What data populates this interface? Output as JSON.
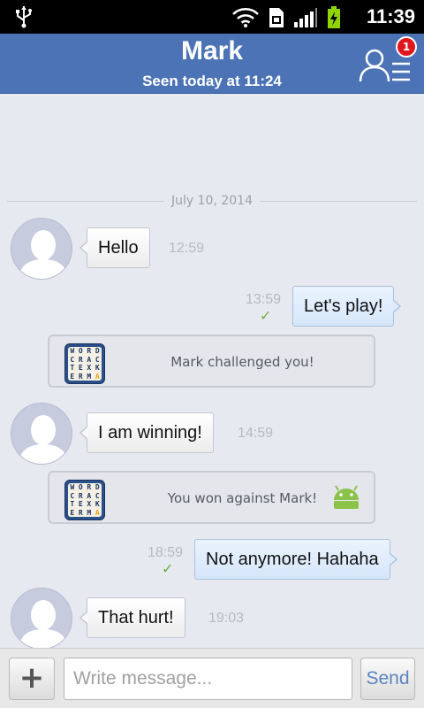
{
  "status_bar": {
    "time": "11:39"
  },
  "header": {
    "contact_name": "Mark",
    "last_seen": "Seen today at 11:24",
    "friend_requests_badge": "1"
  },
  "conversation": {
    "date": "July 10, 2014",
    "messages": [
      {
        "direction": "in",
        "text": "Hello",
        "time": "12:59"
      },
      {
        "direction": "out",
        "text": "Let's play!",
        "time": "13:59",
        "delivered": true
      },
      {
        "type": "event",
        "text": "Mark challenged you!",
        "icon": "wordcrack-game-icon"
      },
      {
        "direction": "in",
        "text": "I am winning!",
        "time": "14:59"
      },
      {
        "type": "event",
        "text": "You won against Mark!",
        "icon": "wordcrack-game-icon",
        "platform_icon": "android-icon"
      },
      {
        "direction": "out",
        "text": "Not anymore! Hahaha",
        "time": "18:59",
        "delivered": true
      },
      {
        "direction": "in",
        "text": "That hurt!",
        "time": "19:03"
      }
    ]
  },
  "composer": {
    "placeholder": "Write message...",
    "send_label": "Send",
    "attach_label": "+"
  },
  "colors": {
    "header_blue": "#4b73b5",
    "badge_red": "#e0171f",
    "check_green": "#6cae3a",
    "send_blue": "#5a84bf"
  }
}
